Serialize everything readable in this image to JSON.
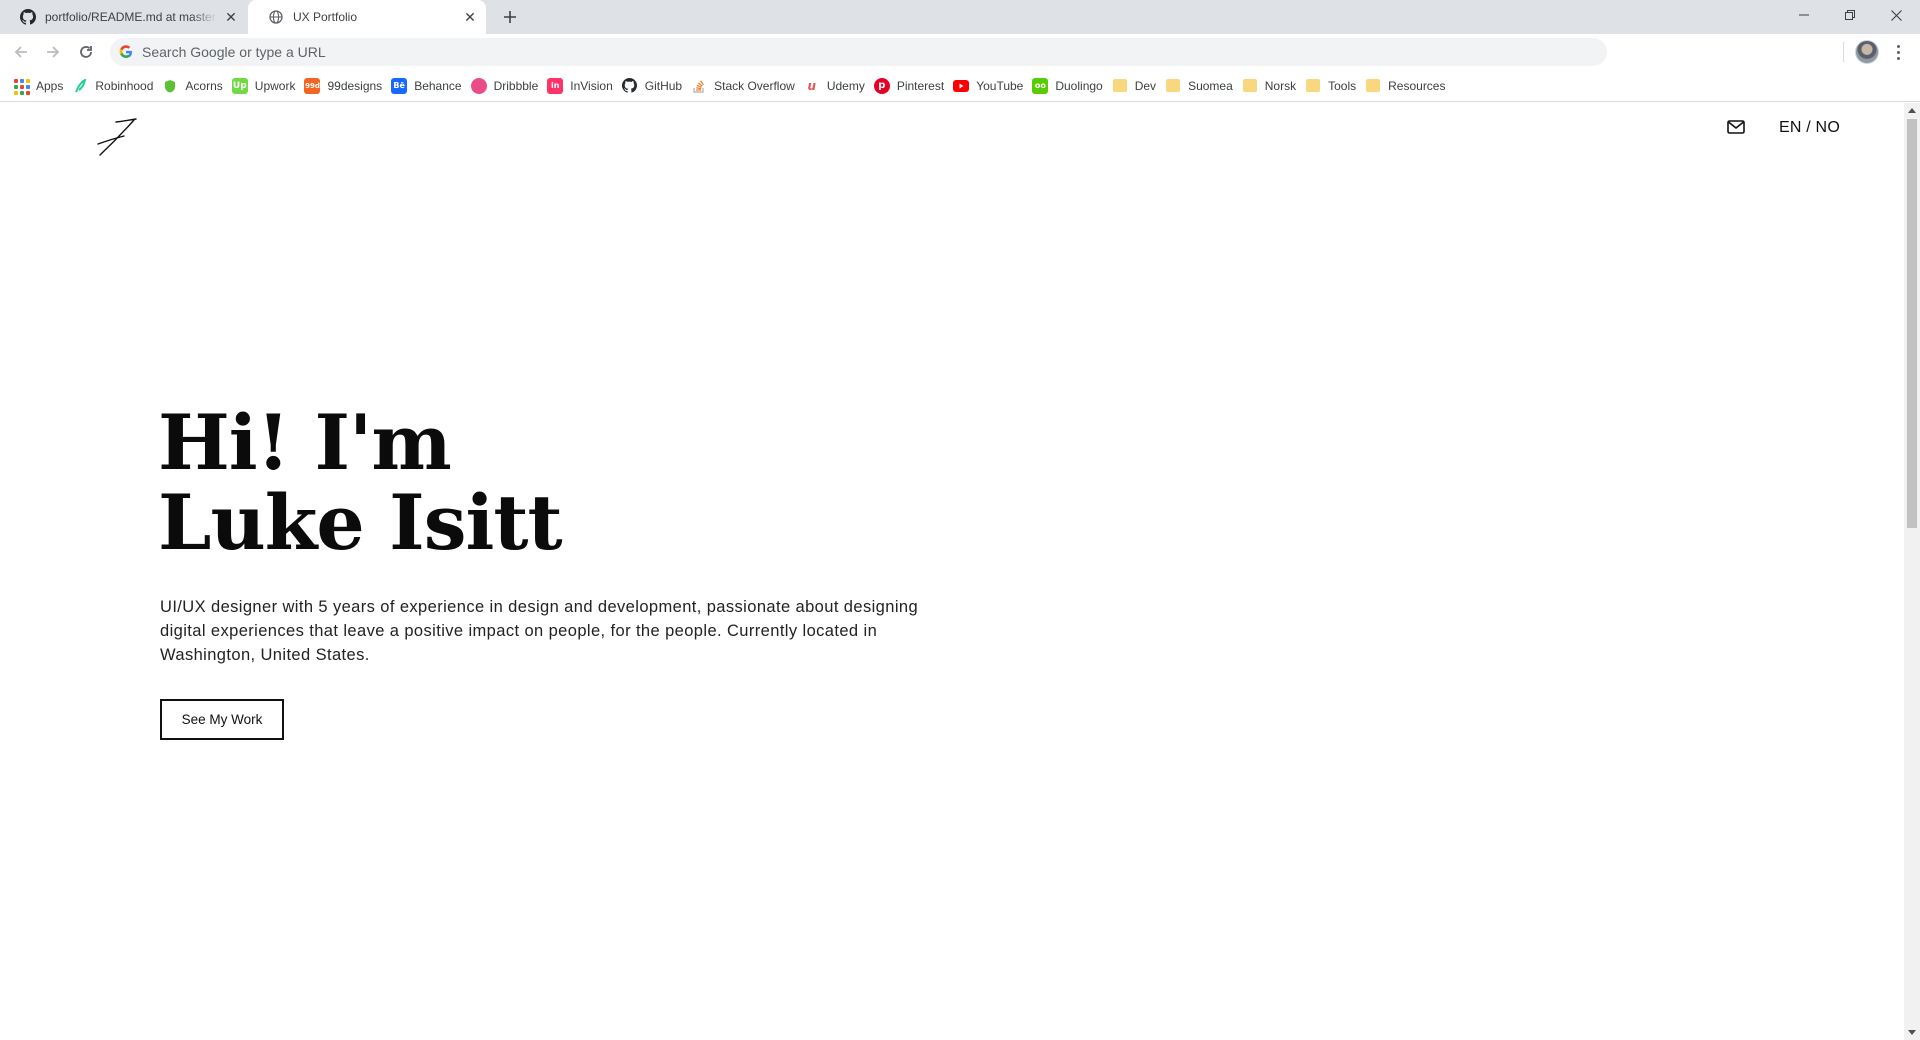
{
  "browser": {
    "tabs": [
      {
        "title": "portfolio/README.md at master",
        "icon": "github-icon",
        "active": false
      },
      {
        "title": "UX Portfolio",
        "icon": "globe-icon",
        "active": true
      }
    ],
    "omnibox_placeholder": "Search Google or type a URL",
    "bookmarks": [
      {
        "label": "Apps",
        "icon": "apps-grid-icon"
      },
      {
        "label": "Robinhood",
        "icon": "robinhood-icon",
        "color": "#21ce99"
      },
      {
        "label": "Acorns",
        "icon": "acorns-icon",
        "color": "#5bc236"
      },
      {
        "label": "Upwork",
        "icon": "upwork-icon",
        "color": "#6fda44"
      },
      {
        "label": "99designs",
        "icon": "99designs-icon",
        "color": "#f26522"
      },
      {
        "label": "Behance",
        "icon": "behance-icon",
        "color": "#1769ff"
      },
      {
        "label": "Dribbble",
        "icon": "dribbble-icon",
        "color": "#ea4c89"
      },
      {
        "label": "InVision",
        "icon": "invision-icon",
        "color": "#ff3366"
      },
      {
        "label": "GitHub",
        "icon": "github-icon",
        "color": "#24292e"
      },
      {
        "label": "Stack Overflow",
        "icon": "stackoverflow-icon",
        "color": "#f48024"
      },
      {
        "label": "Udemy",
        "icon": "udemy-icon",
        "color": "#ec5252"
      },
      {
        "label": "Pinterest",
        "icon": "pinterest-icon",
        "color": "#e60023"
      },
      {
        "label": "YouTube",
        "icon": "youtube-icon",
        "color": "#ff0000"
      },
      {
        "label": "Duolingo",
        "icon": "duolingo-icon",
        "color": "#58cc02"
      },
      {
        "label": "Dev",
        "icon": "folder-icon"
      },
      {
        "label": "Suomea",
        "icon": "folder-icon"
      },
      {
        "label": "Norsk",
        "icon": "folder-icon"
      },
      {
        "label": "Tools",
        "icon": "folder-icon"
      },
      {
        "label": "Resources",
        "icon": "folder-icon"
      }
    ]
  },
  "site": {
    "logo_icon": "signature-logo-icon",
    "nav": {
      "mail_icon": "mail-icon",
      "language": "EN / NO"
    },
    "hero": {
      "title_line1": "Hi! I'm",
      "title_line2": "Luke Isitt",
      "description": "UI/UX designer with 5 years of experience in design and development, passionate about designing digital experiences that leave a positive impact on people, for the people. Currently located in Washington, United States.",
      "cta_label": "See My Work"
    }
  }
}
